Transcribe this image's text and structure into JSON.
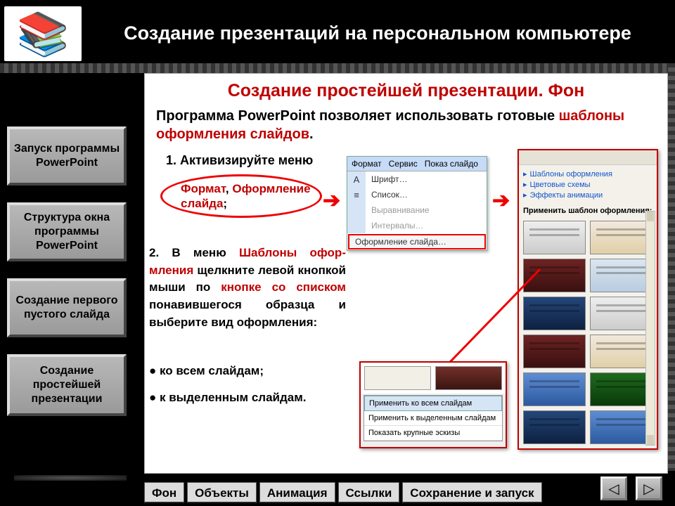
{
  "header": {
    "title": "Создание презентаций на персональном компьютере"
  },
  "sidebar": {
    "items": [
      {
        "label": "Запуск программы PowerPoint"
      },
      {
        "label": "Структура окна программы PowerPoint"
      },
      {
        "label": "Создание первого пустого слайда"
      },
      {
        "label": "Создание простейшей презентации"
      }
    ]
  },
  "main": {
    "subtitle": "Создание простейшей презентации. Фон",
    "intro_plain": "Программа PowerPoint позволяет использовать готовые ",
    "intro_hl": "шаблоны оформления слайдов",
    "intro_end": ".",
    "step1_prefix": "1.   Активизируйте меню",
    "step1_oval_a": "Формат",
    "step1_oval_sep": ", ",
    "step1_oval_b": "Оформление слайда",
    "step1_oval_end": ";",
    "step2": {
      "p1a": "2. В меню ",
      "p1hl1": "Шаблоны офор-мления",
      "p1b": " щелкните левой кнопкой мыши по ",
      "p1hl2": "кнопке со списком",
      "p1c": " понавившегося образца и выберите вид оформления:"
    },
    "bullets": [
      "● ко всем слайдам;",
      "● к выделенным слайдам."
    ],
    "menu": {
      "bar": [
        "Формат",
        "Сервис",
        "Показ слайдо"
      ],
      "items": [
        "Шрифт…",
        "Список…",
        "Выравнивание",
        "Интервалы…"
      ],
      "last": "Оформление слайда…"
    },
    "design_pane": {
      "links": [
        "Шаблоны оформления",
        "Цветовые схемы",
        "Эффекты анимации"
      ],
      "apply": "Применить шаблон оформления:"
    },
    "popup": {
      "items": [
        "Применить ко всем слайдам",
        "Применить к выделенным слайдам",
        "Показать крупные эскизы"
      ]
    }
  },
  "tabs": [
    "Фон",
    "Объекты",
    "Анимация",
    "Ссылки",
    "Сохранение и запуск"
  ],
  "nav": {
    "prev": "◁",
    "next": "▷"
  }
}
